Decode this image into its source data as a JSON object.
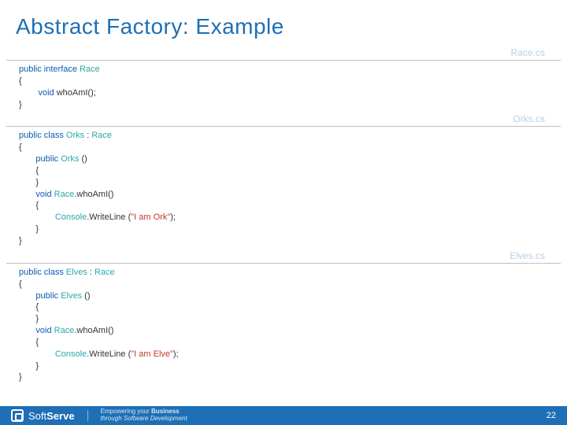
{
  "title": "Abstract Factory: Example",
  "files": {
    "race": {
      "name": "Race.cs",
      "lines": [
        [
          [
            "kw",
            "public interface "
          ],
          [
            "type",
            "Race"
          ]
        ],
        [
          [
            "plain",
            "{"
          ]
        ],
        [
          [
            "plain",
            "        "
          ],
          [
            "kw",
            "void"
          ],
          [
            "plain",
            " whoAmI();"
          ]
        ],
        [
          [
            "plain",
            "}"
          ]
        ]
      ]
    },
    "orks": {
      "name": "Orks.cs",
      "lines": [
        [
          [
            "kw",
            "public class "
          ],
          [
            "type",
            "Orks "
          ],
          [
            "plain",
            ": "
          ],
          [
            "type",
            "Race"
          ]
        ],
        [
          [
            "plain",
            "{"
          ]
        ],
        [
          [
            "plain",
            "       "
          ],
          [
            "kw",
            "public "
          ],
          [
            "type",
            "Orks "
          ],
          [
            "plain",
            "()"
          ]
        ],
        [
          [
            "plain",
            "       {"
          ]
        ],
        [
          [
            "plain",
            "       }"
          ]
        ],
        [
          [
            "plain",
            ""
          ]
        ],
        [
          [
            "plain",
            "       "
          ],
          [
            "kw",
            "void "
          ],
          [
            "type",
            "Race"
          ],
          [
            "plain",
            ".whoAmI()"
          ]
        ],
        [
          [
            "plain",
            "       {"
          ]
        ],
        [
          [
            "plain",
            "               "
          ],
          [
            "type",
            "Console"
          ],
          [
            "plain",
            ".WriteLine ("
          ],
          [
            "str",
            "\"I am Ork\""
          ],
          [
            "plain",
            ");"
          ]
        ],
        [
          [
            "plain",
            "       }"
          ]
        ],
        [
          [
            "plain",
            "}"
          ]
        ]
      ]
    },
    "elves": {
      "name": "Elves.cs",
      "lines": [
        [
          [
            "kw",
            "public class "
          ],
          [
            "type",
            "Elves "
          ],
          [
            "plain",
            ": "
          ],
          [
            "type",
            "Race"
          ]
        ],
        [
          [
            "plain",
            "{"
          ]
        ],
        [
          [
            "plain",
            "       "
          ],
          [
            "kw",
            "public "
          ],
          [
            "type",
            "Elves "
          ],
          [
            "plain",
            "()"
          ]
        ],
        [
          [
            "plain",
            "       {"
          ]
        ],
        [
          [
            "plain",
            "       }"
          ]
        ],
        [
          [
            "plain",
            ""
          ]
        ],
        [
          [
            "plain",
            "       "
          ],
          [
            "kw",
            "void "
          ],
          [
            "type",
            "Race"
          ],
          [
            "plain",
            ".whoAmI()"
          ]
        ],
        [
          [
            "plain",
            "       {"
          ]
        ],
        [
          [
            "plain",
            "               "
          ],
          [
            "type",
            "Console"
          ],
          [
            "plain",
            ".WriteLine ("
          ],
          [
            "str",
            "\"I am Elve\""
          ],
          [
            "plain",
            ");"
          ]
        ],
        [
          [
            "plain",
            "       }"
          ]
        ],
        [
          [
            "plain",
            "}"
          ]
        ]
      ]
    }
  },
  "footer": {
    "brand1": "Soft",
    "brand2": "Serve",
    "tag1": "Empowering your ",
    "tag1b": "Business",
    "tag2": "through Software Development",
    "page": "22"
  }
}
